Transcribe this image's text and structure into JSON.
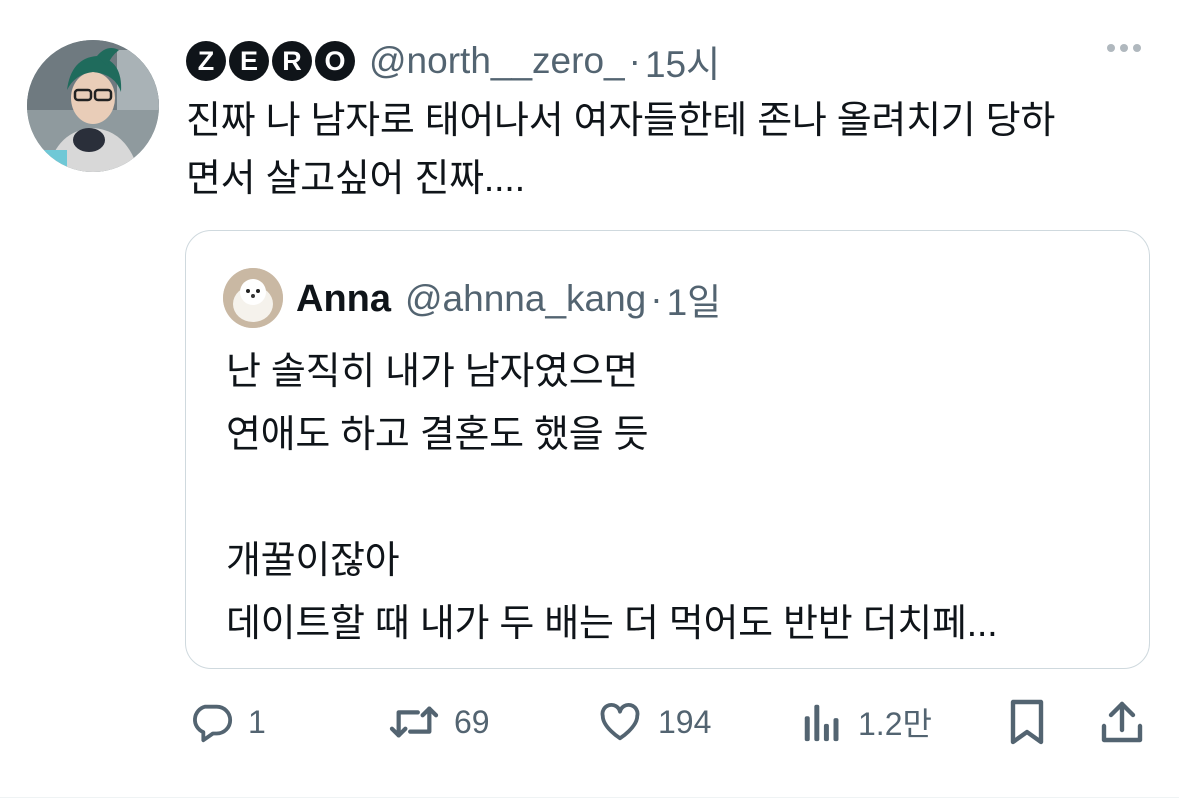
{
  "author": {
    "display_name_letters": [
      "Z",
      "E",
      "R",
      "O"
    ],
    "handle": "@north__zero_",
    "separator": "·",
    "time": "15시"
  },
  "tweet": {
    "text": "진짜 나 남자로 태어나서 여자들한테 존나 올려치기 당하\n면서 살고싶어 진짜...."
  },
  "quoted": {
    "name": "Anna",
    "handle": "@ahnna_kang",
    "separator": "·",
    "time": "1일",
    "text": "난 솔직히 내가 남자였으면\n연애도 하고 결혼도 했을 듯\n\n개꿀이잖아\n데이트할 때 내가 두 배는 더 먹어도 반반 더치페..."
  },
  "actions": {
    "reply_count": "1",
    "retweet_count": "69",
    "like_count": "194",
    "views_count": "1.2만"
  },
  "icons": {
    "more": "more-dots-icon",
    "reply": "reply-bubble-icon",
    "retweet": "retweet-icon",
    "like": "heart-icon",
    "views": "views-chart-icon",
    "bookmark": "bookmark-icon",
    "share": "share-upload-icon"
  },
  "colors": {
    "text_primary": "#0f1419",
    "text_secondary": "#536471",
    "border": "#cfd9de"
  }
}
